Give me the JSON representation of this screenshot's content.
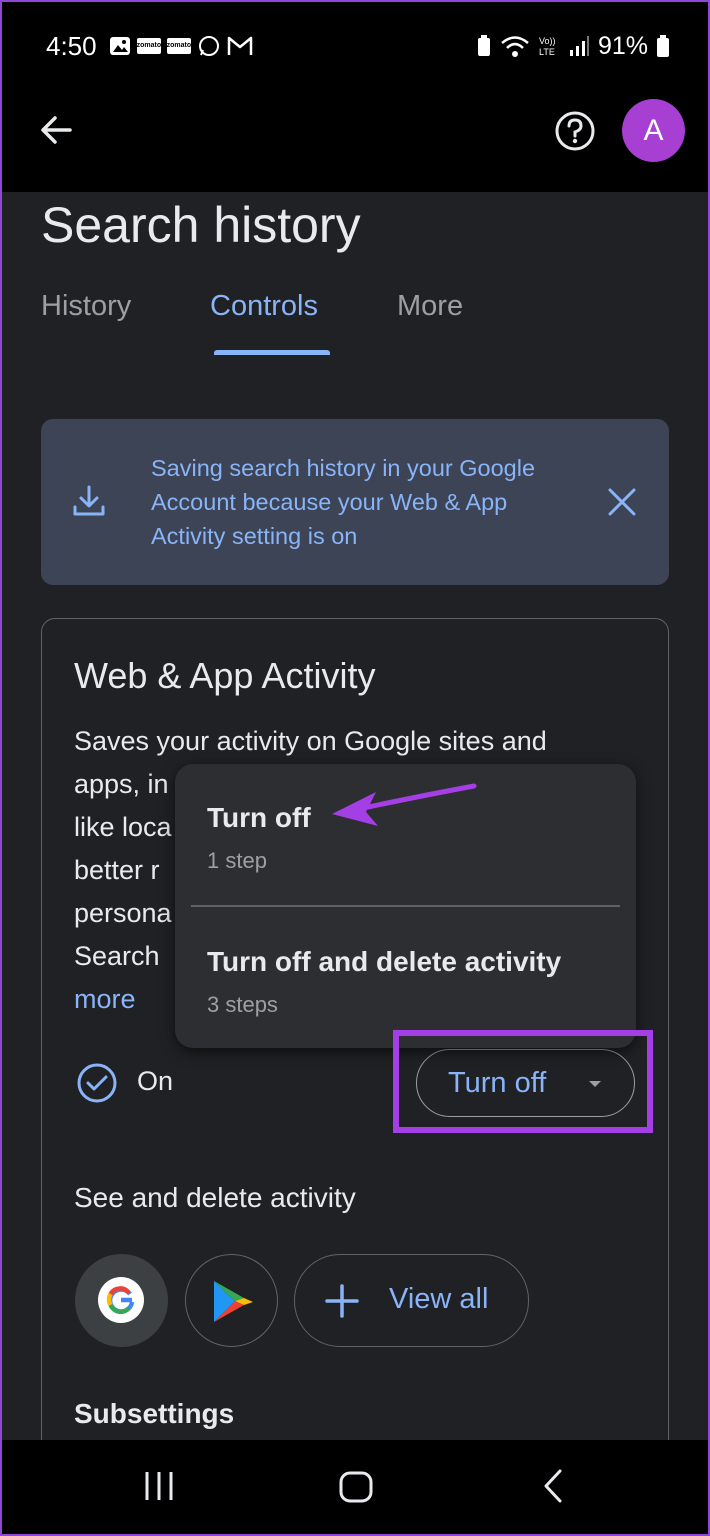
{
  "status_bar": {
    "time": "4:50",
    "notif_mini_1": "zomato",
    "notif_mini_2": "zomato",
    "battery": "91%"
  },
  "header": {
    "avatar_letter": "A"
  },
  "page": {
    "title": "Search history",
    "tabs": [
      {
        "label": "History",
        "active": false
      },
      {
        "label": "Controls",
        "active": true
      },
      {
        "label": "More",
        "active": false
      }
    ]
  },
  "banner": {
    "text": "Saving search history in your Google Account because your Web & App Activity setting is on"
  },
  "card": {
    "title": "Web & App Activity",
    "desc_lines": [
      "Saves your activity on Google sites and",
      "apps, in",
      "like loca",
      "better r",
      "persona",
      "Search"
    ],
    "more": "more",
    "status_label": "On",
    "button_label": "Turn off"
  },
  "menu": {
    "options": [
      {
        "title": "Turn off",
        "subtitle": "1 step"
      },
      {
        "title": "Turn off and delete activity",
        "subtitle": "3 steps"
      }
    ]
  },
  "activity": {
    "title": "See and delete activity",
    "view_all": "View all"
  },
  "subsettings": {
    "title": "Subsettings"
  },
  "colors": {
    "accent": "#8ab4f8",
    "avatar": "#a63fd2",
    "annotation": "#a43fe6"
  }
}
